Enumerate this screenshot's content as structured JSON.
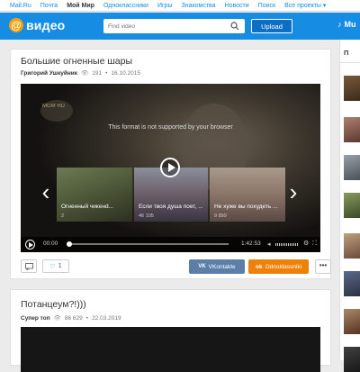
{
  "topnav": {
    "links": [
      "Mail.Ru",
      "Почта",
      "Мой Мир",
      "Одноклассники",
      "Игры",
      "Знакомства",
      "Новости",
      "Поиск",
      "Все проекты ▾"
    ]
  },
  "header": {
    "logo_text": "видео",
    "search_placeholder": "Find video",
    "upload_label": "Upload",
    "music_label": "Mu"
  },
  "video1": {
    "title": "Большие огненные шары",
    "author": "Григорий Ушкуйник",
    "views": "191",
    "date": "16.10.2015",
    "player_message": "This format is not supported by your browser",
    "watermark": "MGM HD",
    "time_current": "00:00",
    "time_total": "1:42:53",
    "related": [
      {
        "title": "Огненный чикенd...",
        "views": "2"
      },
      {
        "title": "Если твоя душа поет, ...",
        "views": "46 105"
      },
      {
        "title": "Не хуже вы похудеть ...",
        "views": "9 899"
      }
    ],
    "likes": "1",
    "vk_label": "VKontakte",
    "ok_label": "Odnoklassniki",
    "more_label": "•••"
  },
  "video2": {
    "title": "Потанцеум?!)))",
    "author": "Супер топ",
    "views": "86 629",
    "date": "22.03.2019"
  },
  "colors": {
    "brand_blue": "#168de2",
    "logo_orange": "#ff9e00",
    "vk": "#5b7fa6",
    "ok": "#ee8208"
  }
}
